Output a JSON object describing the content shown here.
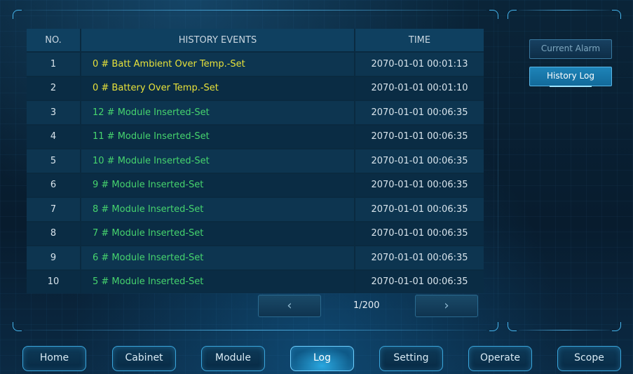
{
  "table": {
    "headers": {
      "no": "NO.",
      "events": "HISTORY EVENTS",
      "time": "TIME"
    },
    "rows": [
      {
        "no": "1",
        "event": "0 # Batt Ambient Over Temp.-Set",
        "time": "2070-01-01  00:01:13",
        "color": "#e8e23a"
      },
      {
        "no": "2",
        "event": "0 # Battery Over Temp.-Set",
        "time": "2070-01-01  00:01:10",
        "color": "#e8e23a"
      },
      {
        "no": "3",
        "event": "12 # Module Inserted-Set",
        "time": "2070-01-01  00:06:35",
        "color": "#46d46e"
      },
      {
        "no": "4",
        "event": "11 # Module Inserted-Set",
        "time": "2070-01-01  00:06:35",
        "color": "#46d46e"
      },
      {
        "no": "5",
        "event": "10 # Module Inserted-Set",
        "time": "2070-01-01  00:06:35",
        "color": "#46d46e"
      },
      {
        "no": "6",
        "event": "9 # Module Inserted-Set",
        "time": "2070-01-01  00:06:35",
        "color": "#46d46e"
      },
      {
        "no": "7",
        "event": "8 # Module Inserted-Set",
        "time": "2070-01-01  00:06:35",
        "color": "#46d46e"
      },
      {
        "no": "8",
        "event": "7 # Module Inserted-Set",
        "time": "2070-01-01  00:06:35",
        "color": "#46d46e"
      },
      {
        "no": "9",
        "event": "6 # Module Inserted-Set",
        "time": "2070-01-01  00:06:35",
        "color": "#46d46e"
      },
      {
        "no": "10",
        "event": "5 # Module Inserted-Set",
        "time": "2070-01-01  00:06:35",
        "color": "#46d46e"
      }
    ]
  },
  "pagination": {
    "prev_icon": "chevron-left-icon",
    "prev": "‹",
    "page": "1/200",
    "next_icon": "chevron-right-icon",
    "next": "›"
  },
  "side": {
    "current_alarm": "Current Alarm",
    "history_log": "History Log"
  },
  "nav": {
    "items": [
      "Home",
      "Cabinet",
      "Module",
      "Log",
      "Setting",
      "Operate",
      "Scope"
    ],
    "active": "Log"
  },
  "colors": {
    "accent": "#46b6ee",
    "warning_event": "#e8e23a",
    "info_event": "#46d46e"
  }
}
